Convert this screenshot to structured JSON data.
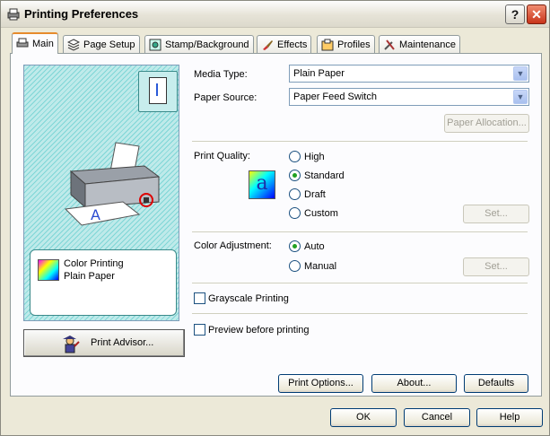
{
  "window": {
    "title": "Printing Preferences",
    "help_label": "?",
    "close_label": "✕"
  },
  "tabs": [
    {
      "label": "Main",
      "icon": "printer-icon"
    },
    {
      "label": "Page Setup",
      "icon": "layers-icon"
    },
    {
      "label": "Stamp/Background",
      "icon": "stamp-icon"
    },
    {
      "label": "Effects",
      "icon": "brush-icon"
    },
    {
      "label": "Profiles",
      "icon": "profile-icon"
    },
    {
      "label": "Maintenance",
      "icon": "tools-icon"
    }
  ],
  "preview": {
    "info_line1": "Color Printing",
    "info_line2": "Plain Paper",
    "advisor_label": "Print Advisor..."
  },
  "media_type": {
    "label": "Media Type:",
    "value": "Plain Paper"
  },
  "paper_source": {
    "label": "Paper Source:",
    "value": "Paper Feed Switch"
  },
  "paper_allocation_label": "Paper Allocation...",
  "print_quality": {
    "label": "Print Quality:",
    "options": [
      "High",
      "Standard",
      "Draft",
      "Custom"
    ],
    "selected": "Standard",
    "set_label": "Set..."
  },
  "color_adjustment": {
    "label": "Color Adjustment:",
    "options": [
      "Auto",
      "Manual"
    ],
    "selected": "Auto",
    "set_label": "Set..."
  },
  "grayscale_label": "Grayscale Printing",
  "preview_label": "Preview before printing",
  "buttons": {
    "print_options": "Print Options...",
    "about": "About...",
    "defaults": "Defaults",
    "ok": "OK",
    "cancel": "Cancel",
    "help": "Help"
  }
}
